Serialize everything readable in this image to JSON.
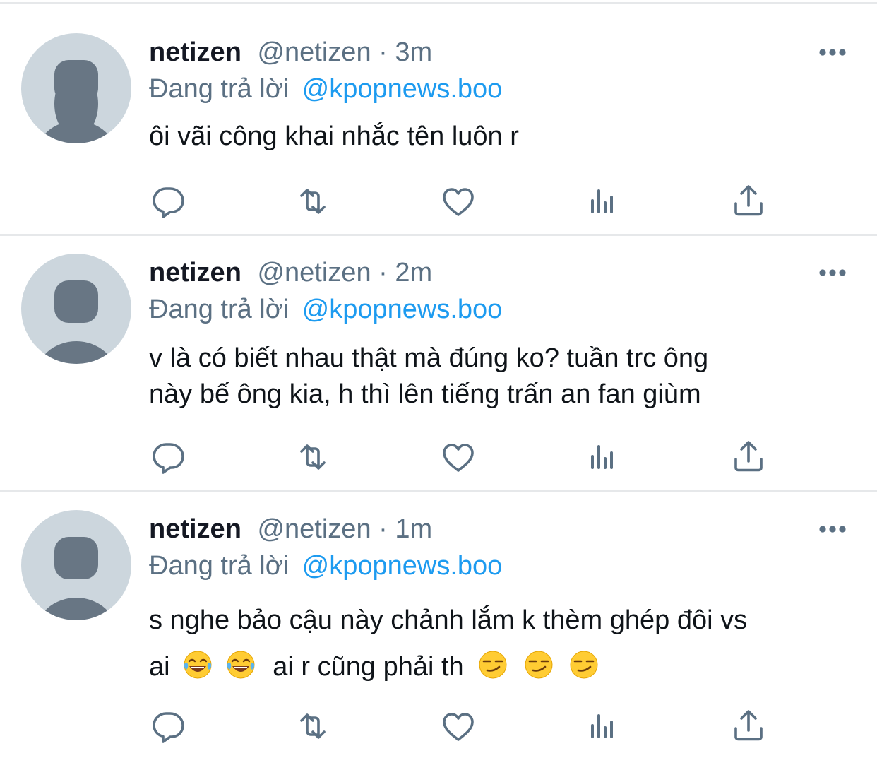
{
  "tweets": [
    {
      "display_name": "netizen",
      "handle": "@netizen",
      "separator": "·",
      "time": "3m",
      "replying_prefix": "Đang trả lời",
      "replying_to": "@kpopnews.boo",
      "text_lines": [
        "ôi vãi công khai nhắc tên luôn r"
      ]
    },
    {
      "display_name": "netizen",
      "handle": "@netizen",
      "separator": "·",
      "time": "2m",
      "replying_prefix": "Đang trả lời",
      "replying_to": "@kpopnews.boo",
      "text_lines": [
        "v là có biết nhau thật mà đúng ko? tuần trc ông",
        "này bế ông kia, h thì lên tiếng trấn an fan giùm"
      ]
    },
    {
      "display_name": "netizen",
      "handle": "@netizen",
      "separator": "·",
      "time": "1m",
      "replying_prefix": "Đang trả lời",
      "replying_to": "@kpopnews.boo",
      "text_lines": [
        "s nghe bảo cậu này chảnh lắm k thèm ghép đôi vs"
      ],
      "text_line2_parts": [
        "ai",
        "ai r cũng phải th"
      ],
      "emojis": [
        "face-with-tears-of-joy",
        "face-with-tears-of-joy",
        "smirking-face",
        "smirking-face",
        "smirking-face"
      ]
    }
  ],
  "icons": {
    "reply": "reply-icon",
    "retweet": "retweet-icon",
    "like": "heart-icon",
    "analytics": "analytics-icon",
    "share": "share-icon",
    "more": "more-options-icon"
  },
  "colors": {
    "accent": "#1d9bf0",
    "secondary_text": "#5b7083",
    "icon": "#5b7083",
    "avatar_bg": "#ccd6dd",
    "avatar_fg": "#687684"
  }
}
